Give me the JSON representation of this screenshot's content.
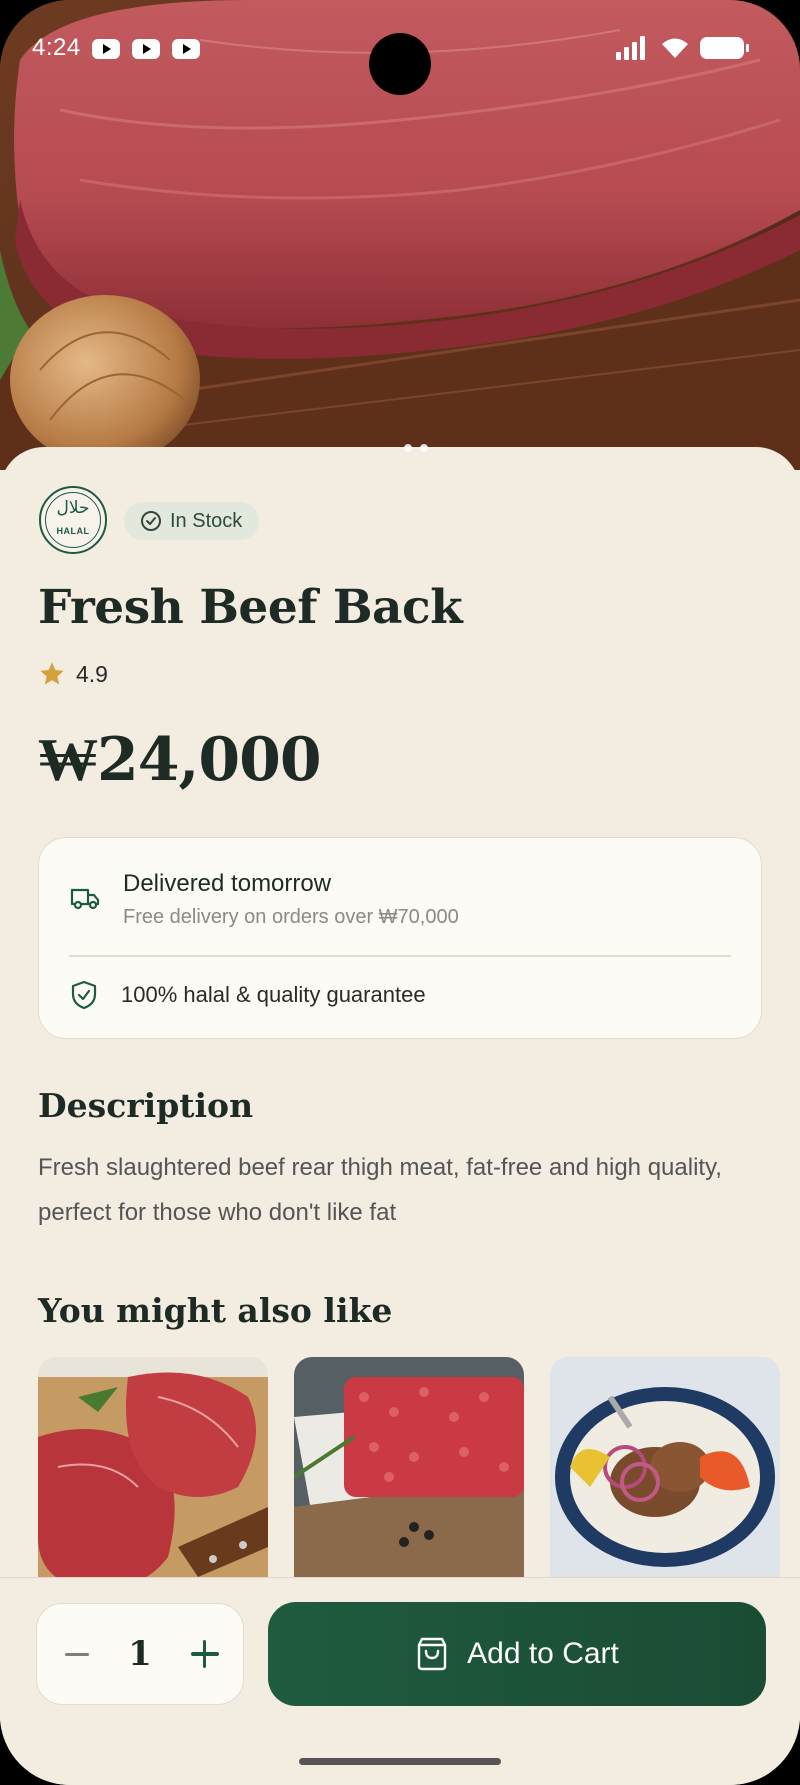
{
  "status_bar": {
    "time": "4:24"
  },
  "product": {
    "badge": {
      "arabic": "حلال",
      "word": "HALAL"
    },
    "stock_label": "In Stock",
    "name": "Fresh Beef Back",
    "rating": "4.9",
    "price": "₩24,000"
  },
  "delivery_card": {
    "delivery_title": "Delivered tomorrow",
    "delivery_sub": "Free delivery on orders over ₩70,000",
    "guarantee": "100% halal & quality guarantee"
  },
  "description": {
    "heading": "Description",
    "text": "Fresh slaughtered beef rear thigh meat, fat-free and high quality, perfect for those who don't like fat"
  },
  "recommendations": {
    "heading": "You might also like"
  },
  "bottom_bar": {
    "quantity": "1",
    "add_to_cart": "Add to Cart"
  },
  "colors": {
    "brand_green": "#1f5b3e",
    "background": "#f2ece1",
    "star": "#d4a23a"
  }
}
